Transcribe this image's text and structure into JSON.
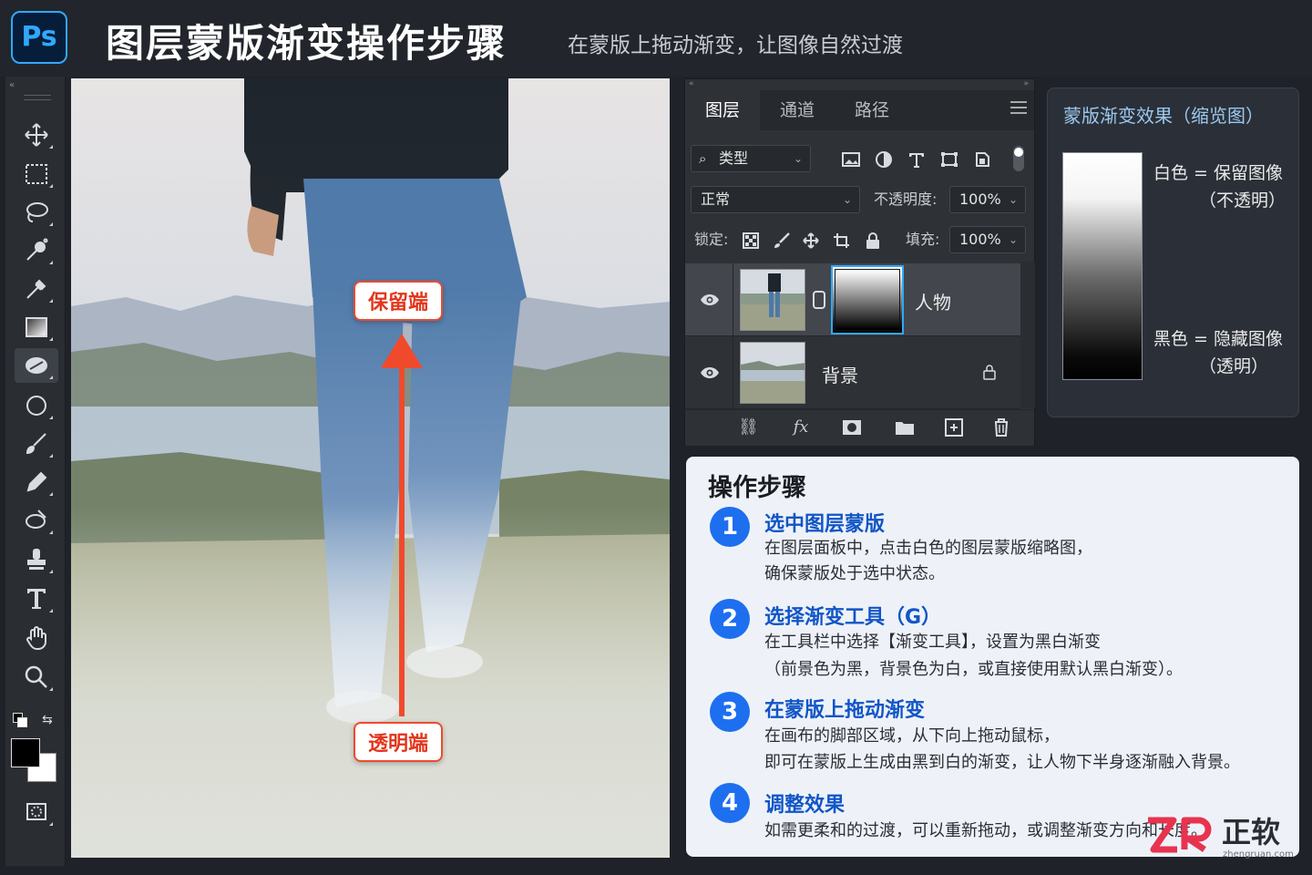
{
  "header": {
    "logo": "Ps",
    "title": "图层蒙版渐变操作步骤",
    "subtitle": "在蒙版上拖动渐变，让图像自然过渡"
  },
  "toolbar": {
    "collapse": "«",
    "tools": [
      {
        "name": "move-tool-icon"
      },
      {
        "name": "marquee-tool-icon"
      },
      {
        "name": "lasso-tool-icon"
      },
      {
        "name": "quick-selection-tool-icon"
      },
      {
        "name": "eyedropper-tool-icon"
      },
      {
        "name": "gradient-tool-icon"
      },
      {
        "name": "eraser-tool-icon"
      },
      {
        "name": "ellipse-tool-icon"
      },
      {
        "name": "brush-tool-icon"
      },
      {
        "name": "pencil-tool-icon"
      },
      {
        "name": "spot-healing-tool-icon"
      },
      {
        "name": "stamp-tool-icon"
      },
      {
        "name": "type-tool-icon"
      },
      {
        "name": "hand-tool-icon"
      },
      {
        "name": "zoom-tool-icon"
      }
    ],
    "foreground_color": "#000000",
    "background_color": "#ffffff"
  },
  "canvas": {
    "top_label": "保留端",
    "bottom_label": "透明端",
    "arrow_color": "#f04a2d"
  },
  "layers_panel": {
    "collapse": "«",
    "close": "»",
    "tabs": [
      "图层",
      "通道",
      "路径"
    ],
    "active_tab": "图层",
    "filter": "类型",
    "blend_mode": "正常",
    "opacity_label": "不透明度:",
    "opacity_value": "100%",
    "lock_label": "锁定:",
    "fill_label": "填充:",
    "fill_value": "100%",
    "layers": [
      {
        "name": "人物",
        "selected": true,
        "has_mask": true
      },
      {
        "name": "背景",
        "selected": false,
        "locked": true
      }
    ],
    "footer_fx": "fx"
  },
  "preview": {
    "title": "蒙版渐变效果（缩览图）",
    "white_label": "白色 = 保留图像",
    "white_sub": "（不透明）",
    "black_label": "黑色 = 隐藏图像",
    "black_sub": "（透明）"
  },
  "steps": {
    "title": "操作步骤",
    "items": [
      {
        "num": "1",
        "title": "选中图层蒙版",
        "lines": [
          "在图层面板中，点击白色的图层蒙版缩略图，",
          "确保蒙版处于选中状态。"
        ]
      },
      {
        "num": "2",
        "title": "选择渐变工具（G）",
        "lines": [
          "在工具栏中选择【渐变工具】，设置为黑白渐变",
          "（前景色为黑，背景色为白，或直接使用默认黑白渐变）。"
        ]
      },
      {
        "num": "3",
        "title": "在蒙版上拖动渐变",
        "lines": [
          "在画布的脚部区域，从下向上拖动鼠标，",
          "即可在蒙版上生成由黑到白的渐变，让人物下半身逐渐融入背景。"
        ]
      },
      {
        "num": "4",
        "title": "调整效果",
        "lines": [
          "如需更柔和的过渡，可以重新拖动，或调整渐变方向和长度。"
        ]
      }
    ]
  },
  "watermark": {
    "text": "正软",
    "sub": "zhengruan.com"
  },
  "colors": {
    "accent": "#31a8ff",
    "step_blue": "#1d6ff0",
    "arrow_red": "#f04a2d"
  }
}
